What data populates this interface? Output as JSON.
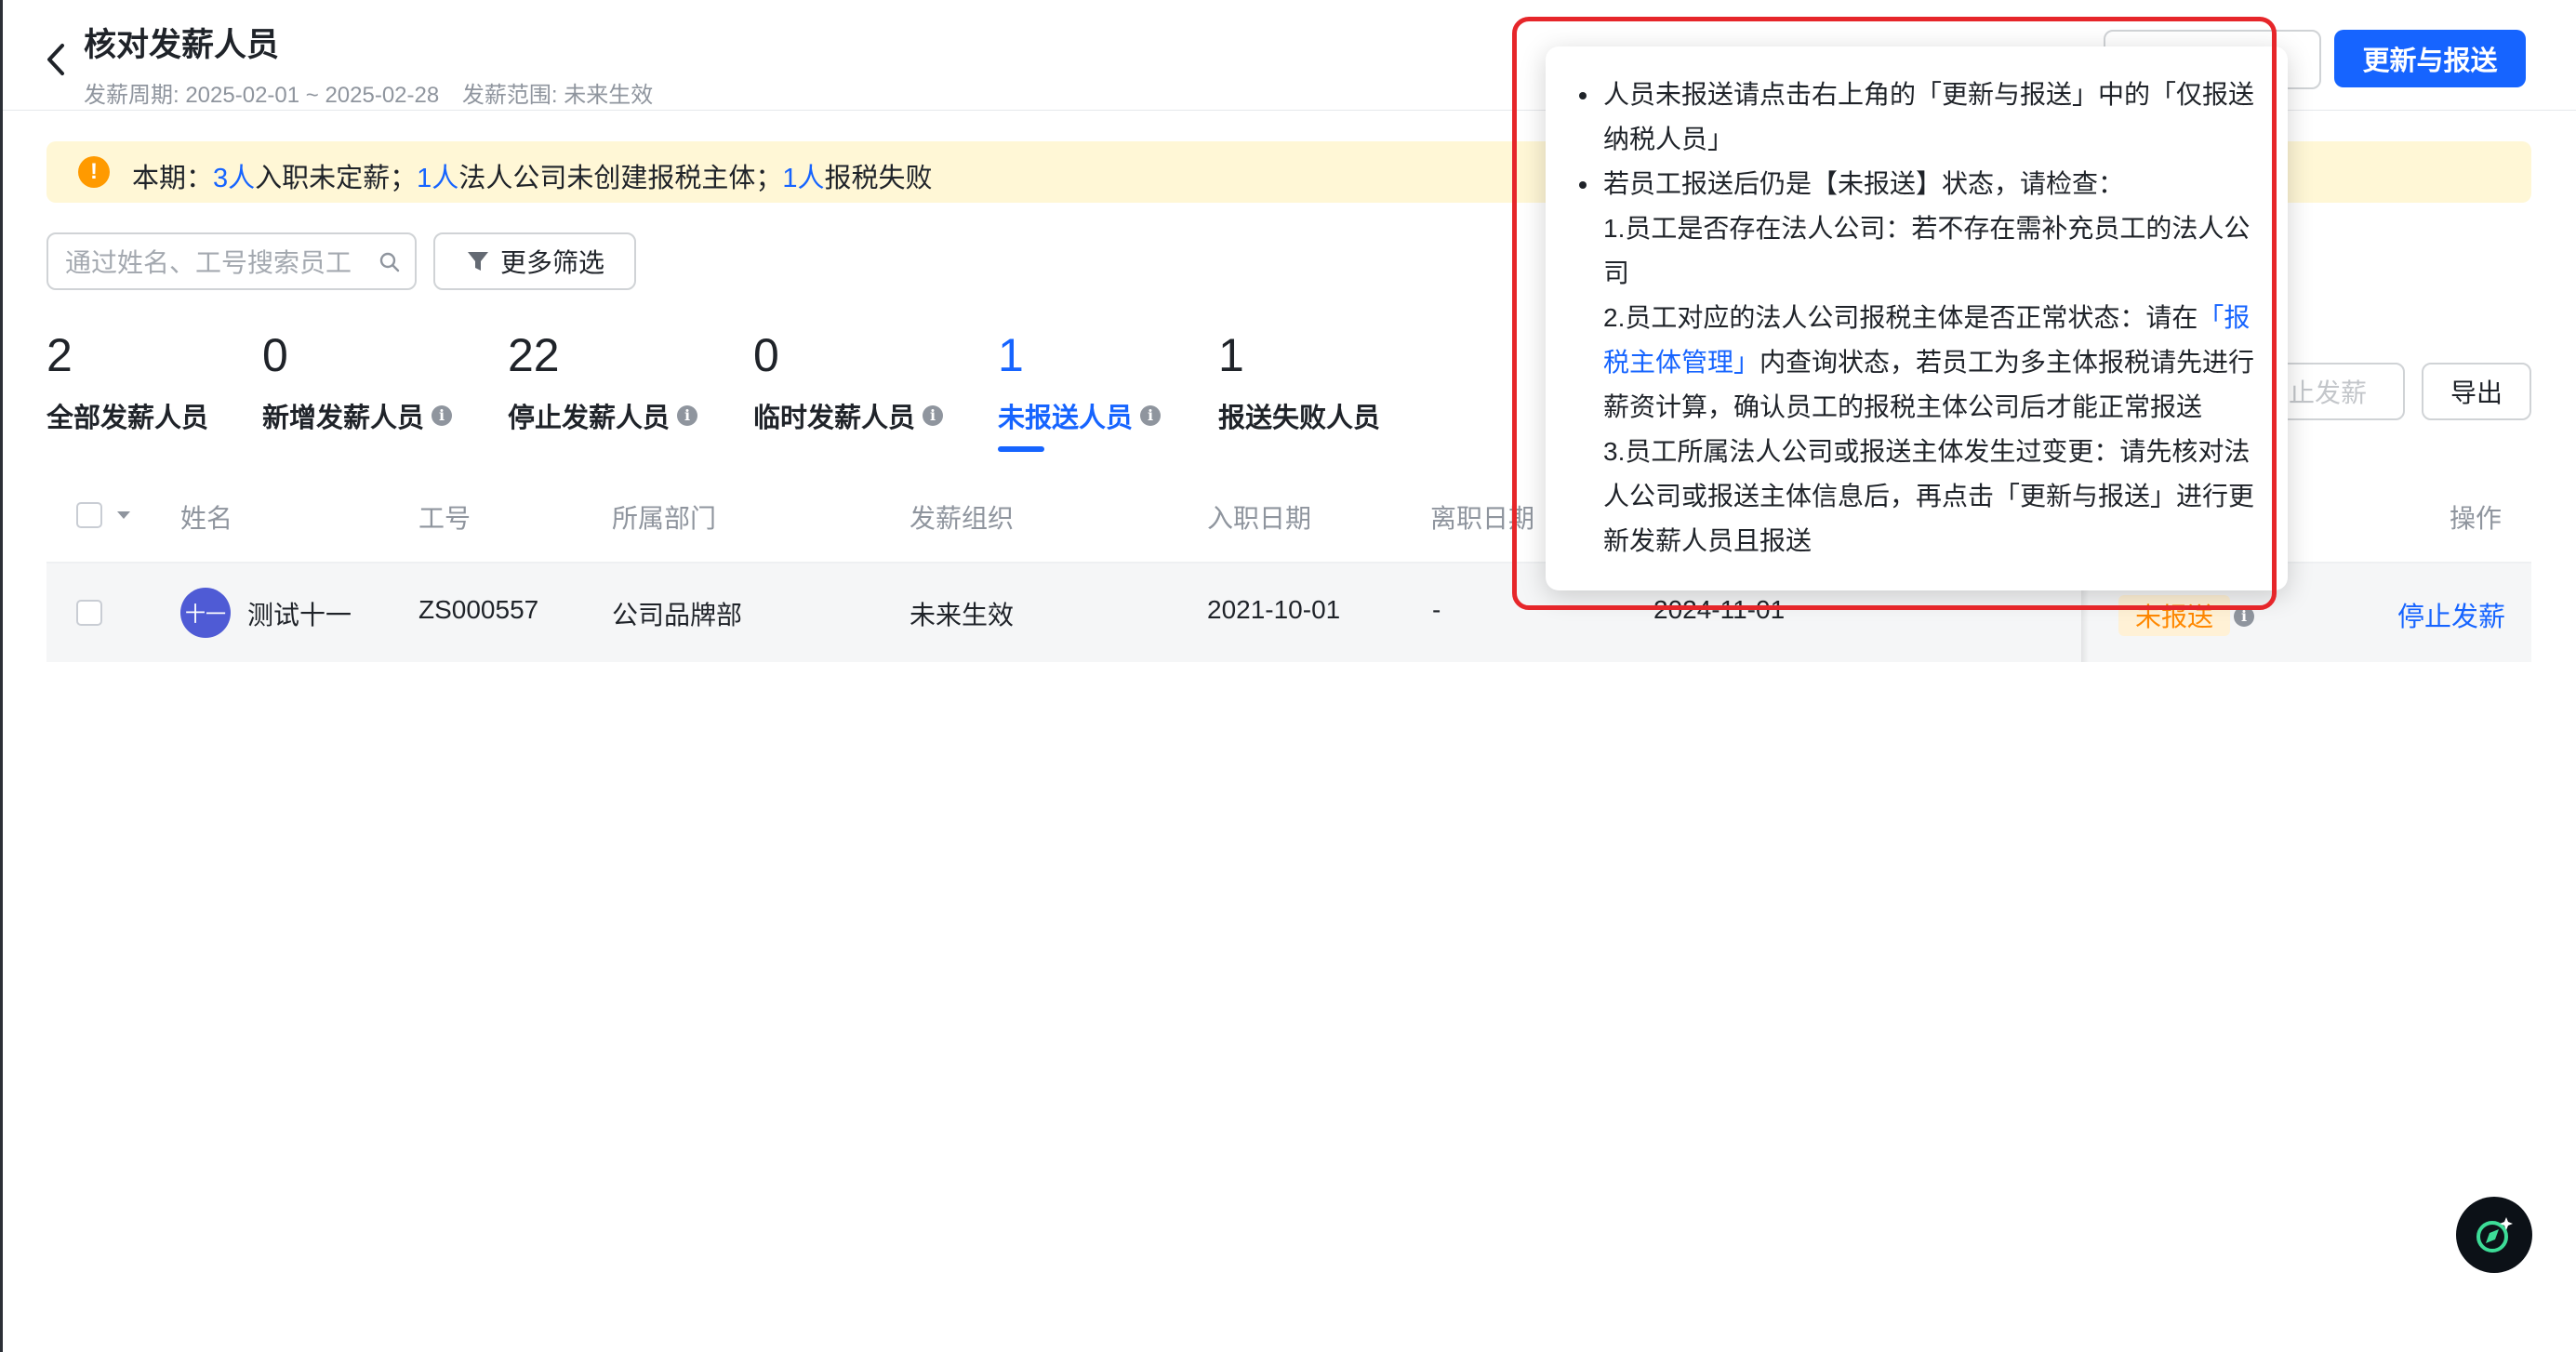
{
  "header": {
    "title": "核对发薪人员",
    "period": "发薪周期: 2025-02-01 ~ 2025-02-28",
    "scope": "发薪范围: 未来生效",
    "primary_button": "更新与报送"
  },
  "notice": {
    "prefix": "本期：",
    "count1": "3人",
    "text1": "入职未定薪；",
    "count2": "1人",
    "text2": "法人公司未创建报税主体；",
    "count3": "1人",
    "text3": "报税失败"
  },
  "search": {
    "placeholder": "通过姓名、工号搜索员工"
  },
  "filter": {
    "label": "更多筛选"
  },
  "stats": [
    {
      "num": "2",
      "label": "全部发薪人员"
    },
    {
      "num": "0",
      "label": "新增发薪人员"
    },
    {
      "num": "22",
      "label": "停止发薪人员"
    },
    {
      "num": "0",
      "label": "临时发薪人员"
    },
    {
      "num": "1",
      "label": "未报送人员"
    },
    {
      "num": "1",
      "label": "报送失败人员"
    }
  ],
  "actions": {
    "stop_all": "停止发薪",
    "export": "导出"
  },
  "table": {
    "columns": [
      "姓名",
      "工号",
      "所属部门",
      "发薪组织",
      "入职日期",
      "离职日期",
      "操作"
    ],
    "rows": [
      {
        "avatar": "十一",
        "name": "测试十一",
        "id": "ZS000557",
        "dept": "公司品牌部",
        "org": "未来生效",
        "hire_date": "2021-10-01",
        "leave_date": "-",
        "extra_date": "2024-11-01",
        "status": "未报送",
        "action": "停止发薪"
      }
    ]
  },
  "tooltip": {
    "b1_a": "人员未报送请点击右上角的「更新与报送」中的「仅报送",
    "b1_b": "纳税人员」",
    "b2": "若员工报送后仍是【未报送】状态，请检查：",
    "i1_a": "1.员工是否存在法人公司：若不存在需补充员工的法人公",
    "i1_b": "司",
    "i2_a": "2.员工对应的法人公司报税主体是否正常状态：请在",
    "i2_link_a": "「报",
    "i2_link_b": "税主体管理」",
    "i2_b": "内查询状态，若员工为多主体报税请先进行",
    "i2_c": "薪资计算，确认员工的报税主体公司后才能正常报送",
    "i3_a": "3.员工所属法人公司或报送主体发生过变更：请先核对法",
    "i3_b": "人公司或报送主体信息后，再点击「更新与报送」进行更",
    "i3_c": "新发薪人员且报送"
  },
  "colors": {
    "primary": "#1664ff",
    "warning": "#ff9a00",
    "highlight": "#e6262a"
  }
}
